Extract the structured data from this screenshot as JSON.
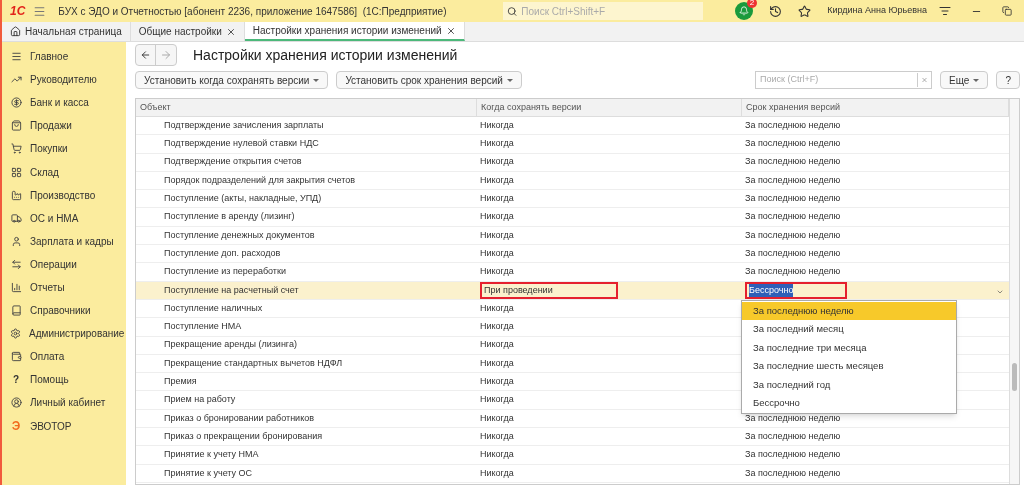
{
  "app": {
    "logo": "1С",
    "title": "БУХ с ЭДО и Отчетностью [абонент 2236, приложение 1647586]  (1С:Предприятие)",
    "search_placeholder": "Поиск Ctrl+Shift+F",
    "notifications": "2",
    "user": "Кирдина Анна Юрьевна"
  },
  "tabs": [
    {
      "label": "Начальная страница",
      "selected": false,
      "closable": false
    },
    {
      "label": "Общие настройки",
      "selected": false,
      "closable": true
    },
    {
      "label": "Настройки хранения истории изменений",
      "selected": true,
      "closable": true
    }
  ],
  "sidebar": [
    {
      "label": "Главное"
    },
    {
      "label": "Руководителю"
    },
    {
      "label": "Банк и касса"
    },
    {
      "label": "Продажи"
    },
    {
      "label": "Покупки"
    },
    {
      "label": "Склад"
    },
    {
      "label": "Производство"
    },
    {
      "label": "ОС и НМА"
    },
    {
      "label": "Зарплата и кадры"
    },
    {
      "label": "Операции"
    },
    {
      "label": "Отчеты"
    },
    {
      "label": "Справочники"
    },
    {
      "label": "Администрирование"
    },
    {
      "label": "Оплата"
    },
    {
      "label": "Помощь",
      "glyph": "?"
    },
    {
      "label": "Личный кабинет"
    },
    {
      "label": "ЭВОТОР",
      "glyph": "Э"
    }
  ],
  "form": {
    "title": "Настройки хранения истории изменений",
    "toolbar": [
      "Установить когда сохранять версии",
      "Установить срок хранения версий"
    ],
    "search_placeholder": "Поиск (Ctrl+F)",
    "more": "Еще",
    "help": "?"
  },
  "table": {
    "columns": [
      "Объект",
      "Когда сохранять версии",
      "Срок хранения версий"
    ],
    "rows": [
      {
        "object": "Подтверждение зачисления зарплаты",
        "when": "Никогда",
        "period": "За последнюю неделю",
        "selected": false
      },
      {
        "object": "Подтверждение нулевой ставки НДС",
        "when": "Никогда",
        "period": "За последнюю неделю",
        "selected": false
      },
      {
        "object": "Подтверждение открытия счетов",
        "when": "Никогда",
        "period": "За последнюю неделю",
        "selected": false
      },
      {
        "object": "Порядок подразделений для закрытия счетов",
        "when": "Никогда",
        "period": "За последнюю неделю",
        "selected": false
      },
      {
        "object": "Поступление (акты, накладные, УПД)",
        "when": "Никогда",
        "period": "За последнюю неделю",
        "selected": false
      },
      {
        "object": "Поступление в аренду (лизинг)",
        "when": "Никогда",
        "period": "За последнюю неделю",
        "selected": false
      },
      {
        "object": "Поступление денежных документов",
        "when": "Никогда",
        "period": "За последнюю неделю",
        "selected": false
      },
      {
        "object": "Поступление доп. расходов",
        "when": "Никогда",
        "period": "За последнюю неделю",
        "selected": false
      },
      {
        "object": "Поступление из переработки",
        "when": "Никогда",
        "period": "За последнюю неделю",
        "selected": false
      },
      {
        "object": "Поступление на расчетный счет",
        "when": "При проведении",
        "period": "Бессрочно",
        "selected": true
      },
      {
        "object": "Поступление наличных",
        "when": "Никогда",
        "selected": false
      },
      {
        "object": "Поступление НМА",
        "when": "Никогда",
        "selected": false
      },
      {
        "object": "Прекращение аренды (лизинга)",
        "when": "Никогда",
        "selected": false
      },
      {
        "object": "Прекращение стандартных вычетов НДФЛ",
        "when": "Никогда",
        "selected": false
      },
      {
        "object": "Премия",
        "when": "Никогда",
        "selected": false
      },
      {
        "object": "Прием на работу",
        "when": "Никогда",
        "selected": false
      },
      {
        "object": "Приказ о бронировании работников",
        "when": "Никогда",
        "period": "За последнюю неделю",
        "selected": false
      },
      {
        "object": "Приказ о прекращении бронирования",
        "when": "Никогда",
        "period": "За последнюю неделю",
        "selected": false
      },
      {
        "object": "Принятие к учету НМА",
        "when": "Никогда",
        "period": "За последнюю неделю",
        "selected": false
      },
      {
        "object": "Принятие к учету ОС",
        "when": "Никогда",
        "period": "За последнюю неделю",
        "selected": false
      }
    ]
  },
  "dropdown": [
    {
      "label": "За последнюю неделю",
      "selected": true
    },
    {
      "label": "За последний месяц",
      "selected": false
    },
    {
      "label": "За последние три месяца",
      "selected": false
    },
    {
      "label": "За последние шесть месяцев",
      "selected": false
    },
    {
      "label": "За последний год",
      "selected": false
    },
    {
      "label": "Бессрочно",
      "selected": false
    }
  ]
}
